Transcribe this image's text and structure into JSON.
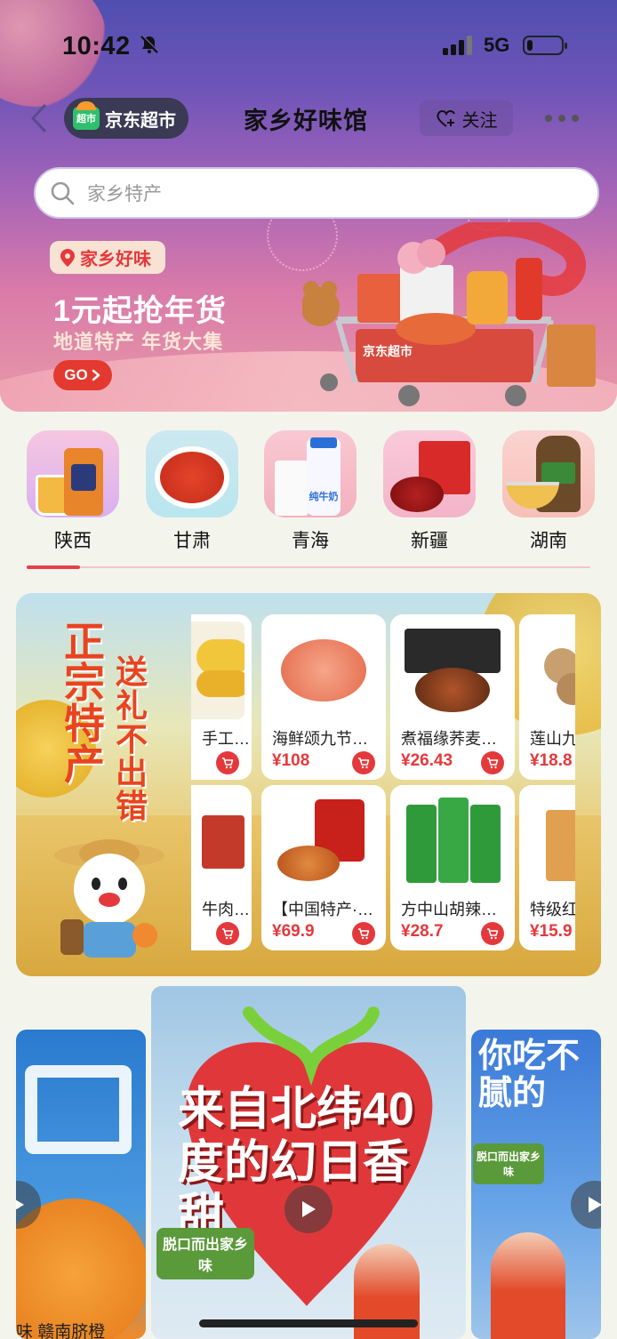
{
  "status_bar": {
    "time": "10:42",
    "network": "5G",
    "battery_level": 0.15
  },
  "nav": {
    "brand_badge": "超市",
    "brand": "京东超市",
    "title": "家乡好味馆",
    "follow_label": "关注"
  },
  "search": {
    "placeholder": "家乡特产"
  },
  "banner": {
    "tag": "家乡好味",
    "headline": "1元起抢年货",
    "subline": "地道特产 年货大集",
    "go_label": "GO",
    "cart_brand": "京东超市"
  },
  "categories": [
    {
      "label": "陕西"
    },
    {
      "label": "甘肃"
    },
    {
      "label": "青海"
    },
    {
      "label": "新疆"
    },
    {
      "label": "湖南"
    }
  ],
  "category_art": {
    "milk_label": "纯牛奶"
  },
  "promo": {
    "slogan_line1": "正宗特产",
    "slogan_line2": "送礼不出错",
    "products": [
      {
        "name": "手工…",
        "price": ""
      },
      {
        "name": "海鲜颂九节…",
        "price": "¥108"
      },
      {
        "name": "煮福缘荞麦…",
        "price": "¥26.43"
      },
      {
        "name": "莲山九",
        "price": "¥18.8"
      },
      {
        "name": "牛肉…",
        "price": ""
      },
      {
        "name": "【中国特产·…",
        "price": "¥69.9"
      },
      {
        "name": "方中山胡辣…",
        "price": "¥28.7"
      },
      {
        "name": "特级红",
        "price": "¥15.9"
      }
    ]
  },
  "videos": {
    "left_caption": "味 赣南脐橙",
    "center_text": "来自北纬40度的幻日香甜",
    "center_badge": "脱口而出家乡味",
    "right_text": "你吃不腻的",
    "right_badge": "脱口而出家乡味"
  },
  "colors": {
    "accent": "#e4393c",
    "brand_green": "#2fbf6e",
    "page_bg": "#f3f5ec"
  }
}
